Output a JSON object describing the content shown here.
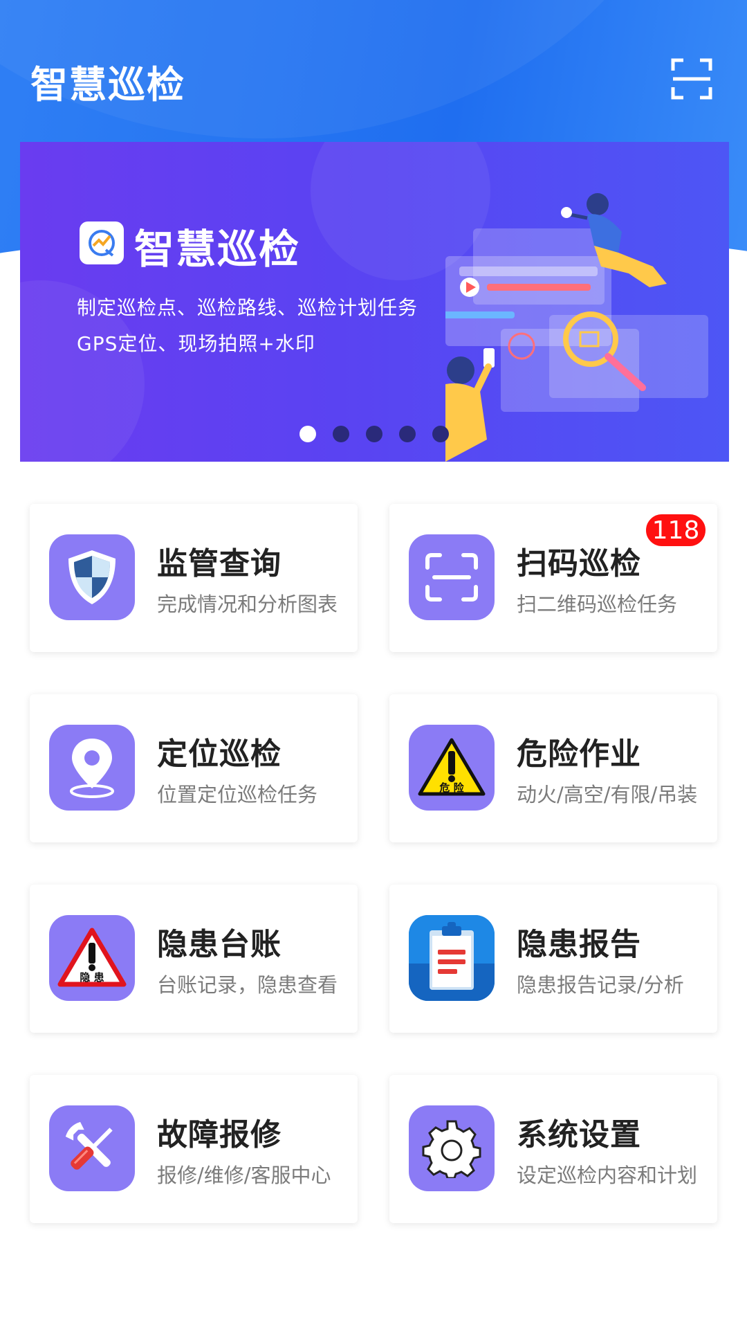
{
  "header": {
    "title": "智慧巡检",
    "scan_icon": "scan-frame-icon"
  },
  "banner": {
    "logo_icon": "app-logo-icon",
    "title": "智慧巡检",
    "line1": "制定巡检点、巡检路线、巡检计划任务",
    "line2": "GPS定位、现场拍照+水印",
    "dots_total": 5,
    "active_dot": 1
  },
  "cards": [
    {
      "title": "监管查询",
      "subtitle": "完成情况和分析图表",
      "icon": "shield-icon"
    },
    {
      "title": "扫码巡检",
      "subtitle": "扫二维码巡检任务",
      "icon": "scan-icon",
      "badge": "118"
    },
    {
      "title": "定位巡检",
      "subtitle": "位置定位巡检任务",
      "icon": "location-pin-icon"
    },
    {
      "title": "危险作业",
      "subtitle": "动火/高空/有限/吊装",
      "icon": "warning-triangle-icon",
      "icon_text": "危 险"
    },
    {
      "title": "隐患台账",
      "subtitle": "台账记录，隐患查看",
      "icon": "hazard-triangle-icon",
      "icon_text": "隐 患"
    },
    {
      "title": "隐患报告",
      "subtitle": "隐患报告记录/分析",
      "icon": "clipboard-report-icon"
    },
    {
      "title": "故障报修",
      "subtitle": "报修/维修/客服中心",
      "icon": "tools-icon"
    },
    {
      "title": "系统设置",
      "subtitle": "设定巡检内容和计划",
      "icon": "gear-icon"
    }
  ],
  "colors": {
    "header_blue": "#2f7ff4",
    "icon_purple": "#8b7bf5",
    "badge_red": "#ff1010"
  }
}
